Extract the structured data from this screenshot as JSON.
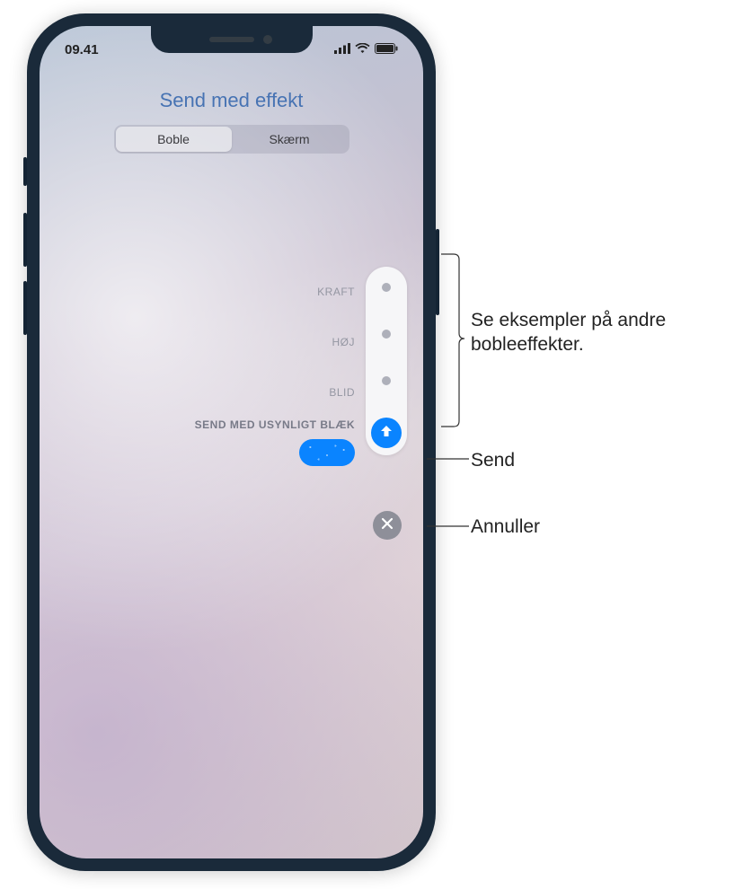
{
  "status": {
    "time": "09.41"
  },
  "title": "Send med effekt",
  "tabs": {
    "bubble": "Boble",
    "screen": "Skærm"
  },
  "effects": {
    "slam": "KRAFT",
    "loud": "HØJ",
    "gentle": "BLID",
    "invisible": "SEND MED USYNLIGT BLÆK"
  },
  "callouts": {
    "preview": "Se eksempler på andre bobleeffekter.",
    "send": "Send",
    "cancel": "Annuller"
  }
}
